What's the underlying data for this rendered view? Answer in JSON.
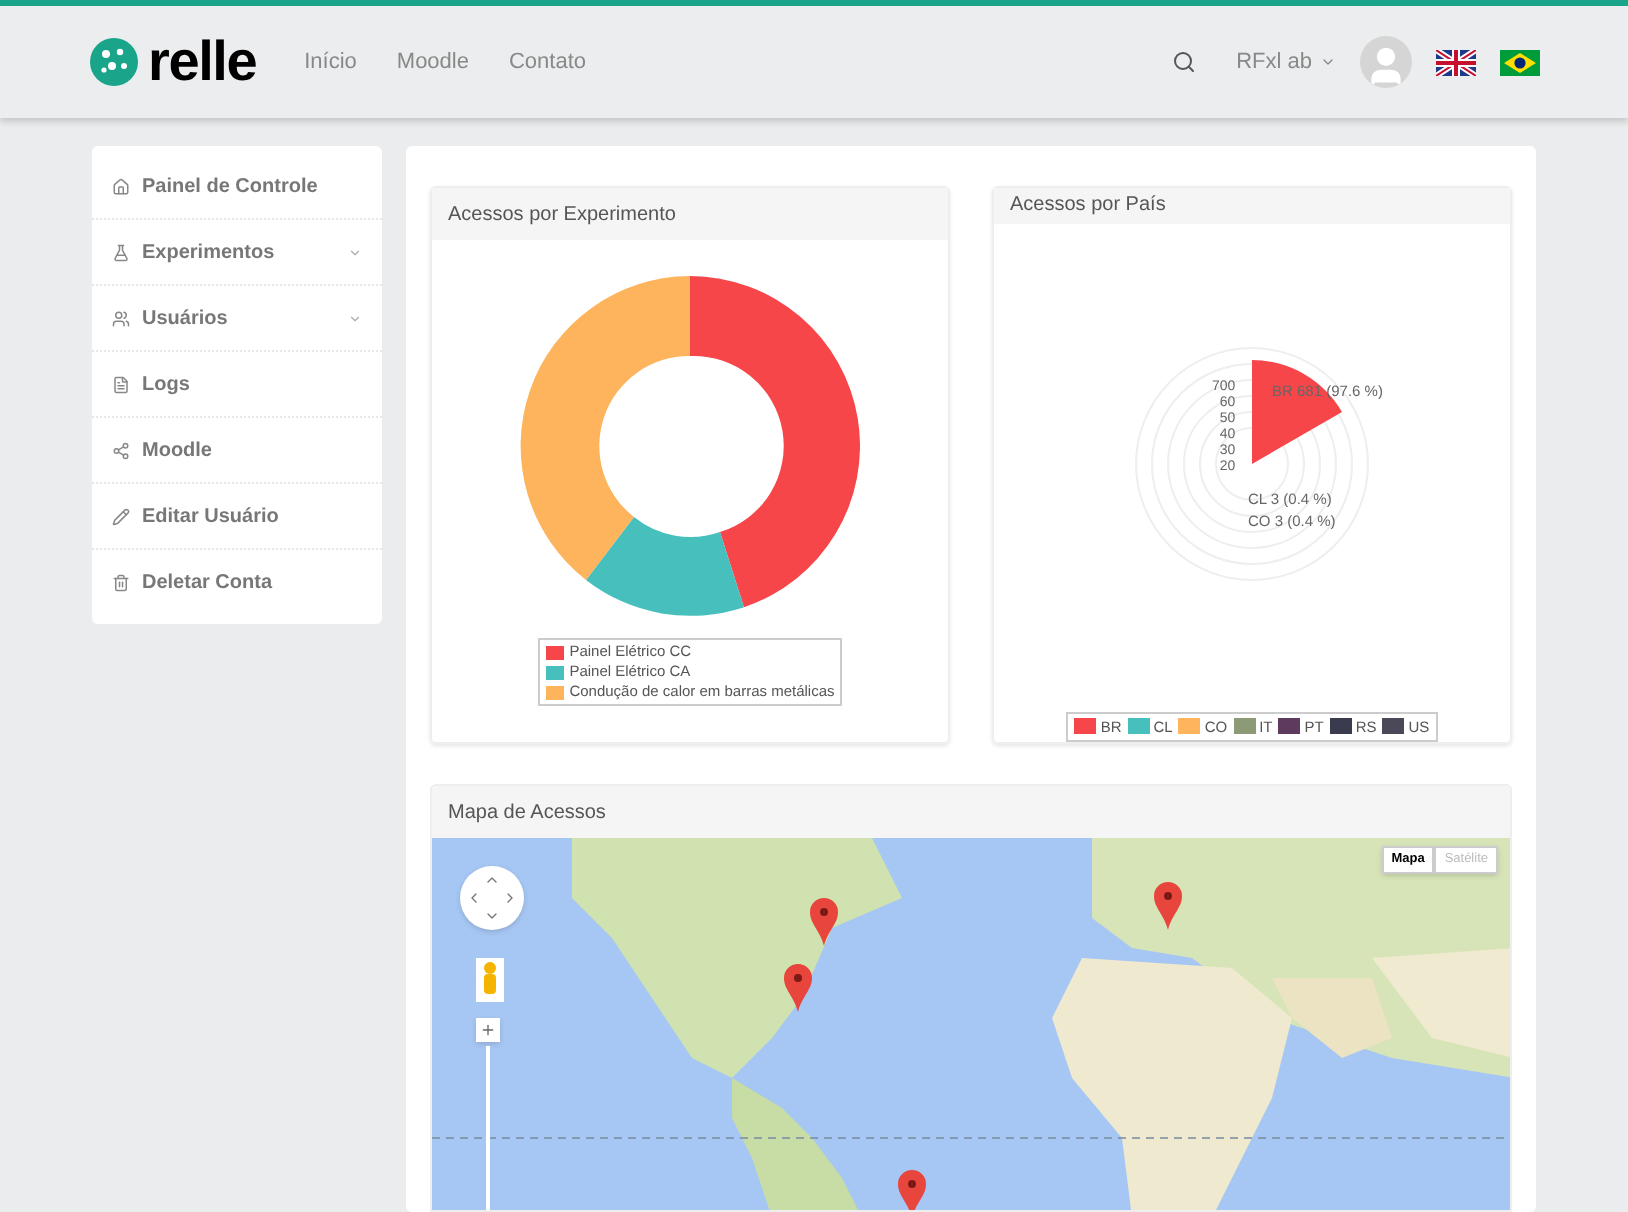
{
  "header": {
    "logo": "relle",
    "nav": [
      {
        "label": "Início",
        "selected": false
      },
      {
        "label": "Moodle",
        "selected": false
      },
      {
        "label": "Contato",
        "selected": false
      }
    ],
    "user": "RFxl ab"
  },
  "sidebar": {
    "items": [
      {
        "label": "Painel de Controle",
        "has_caret": false
      },
      {
        "label": "Experimentos",
        "has_caret": true
      },
      {
        "label": "Usuários",
        "has_caret": true
      },
      {
        "label": "Logs",
        "has_caret": false
      },
      {
        "label": "Moodle",
        "has_caret": false
      },
      {
        "label": "Editar Usuário",
        "has_caret": false
      },
      {
        "label": "Deletar Conta",
        "has_caret": false
      }
    ]
  },
  "experiment_card": {
    "title": "Acessos por Experimento",
    "legend": [
      {
        "label": "Painel Elétrico CC",
        "color": "#f7464a"
      },
      {
        "label": "Painel Elétrico CA",
        "color": "#46bfbd"
      },
      {
        "label": "Condução de calor em barras metálicas",
        "color": "#fdb45c"
      }
    ]
  },
  "country_card": {
    "title": "Acessos por País",
    "ticks": [
      "700",
      "60",
      "50",
      "40",
      "30",
      "20"
    ],
    "labels": [
      "BR 681 (97.6 %)",
      "CL 3 (0.4 %)",
      "CO 3 (0.4 %)"
    ],
    "legend": [
      {
        "label": "BR",
        "color": "#f7464a"
      },
      {
        "label": "CL",
        "color": "#46bfbd"
      },
      {
        "label": "CO",
        "color": "#fdb45c"
      },
      {
        "label": "IT",
        "color": "#8c9a78"
      },
      {
        "label": "PT",
        "color": "#5e3b5e"
      },
      {
        "label": "RS",
        "color": "#3b3b4f"
      },
      {
        "label": "US",
        "color": "#4b4858"
      }
    ]
  },
  "map_card": {
    "title": "Mapa de Acessos",
    "map_types": [
      {
        "label": "Mapa",
        "selected": true
      },
      {
        "label": "Satélite",
        "selected": false
      }
    ]
  }
}
